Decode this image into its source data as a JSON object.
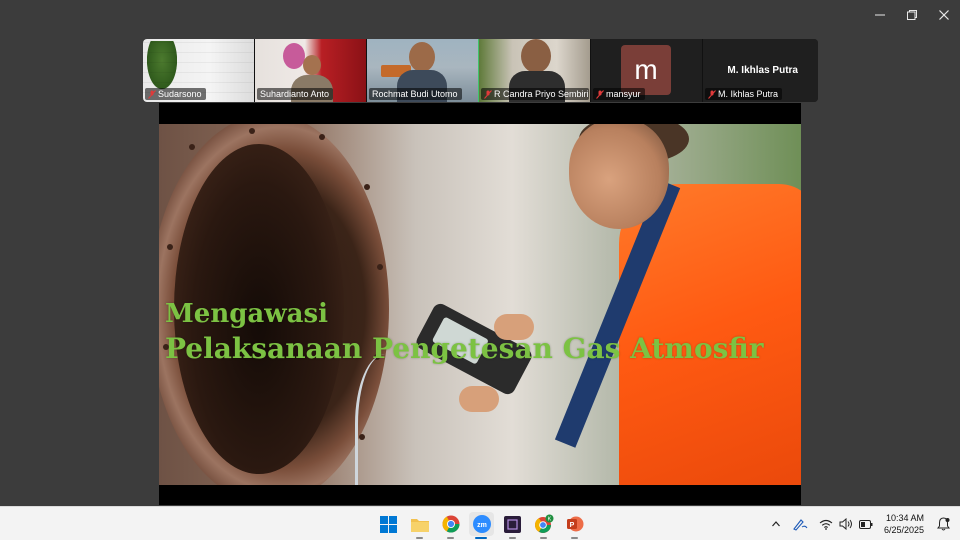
{
  "window": {
    "controls": [
      "minimize",
      "restore",
      "close"
    ]
  },
  "participants": [
    {
      "name": "Sudarsono",
      "muted": true,
      "speaking": false
    },
    {
      "name": "Suhardianto Anto",
      "muted": false,
      "speaking": false
    },
    {
      "name": "Rochmat Budi Utomo",
      "muted": false,
      "speaking": true
    },
    {
      "name": "R Candra Priyo Sembiring",
      "muted": true,
      "speaking": false
    },
    {
      "name": "mansyur",
      "muted": true,
      "speaking": false,
      "avatar_letter": "m"
    },
    {
      "name": "M. Ikhlas Putra",
      "muted": true,
      "speaking": false,
      "display_name": "M. Ikhlas Putra"
    }
  ],
  "slide": {
    "title_line1": "Mengawasi",
    "title_line2": "Pelaksanaan Pengetesan Gas Atmosfir",
    "title_color": "#7cc243"
  },
  "taskbar": {
    "apps": [
      "windows-start",
      "file-explorer",
      "chrome",
      "zoom",
      "meeting-app",
      "chrome-profile",
      "powerpoint"
    ],
    "active_app": "zoom",
    "chrome_profile_badge": "K",
    "time": "10:34 AM",
    "date": "6/25/2025"
  }
}
